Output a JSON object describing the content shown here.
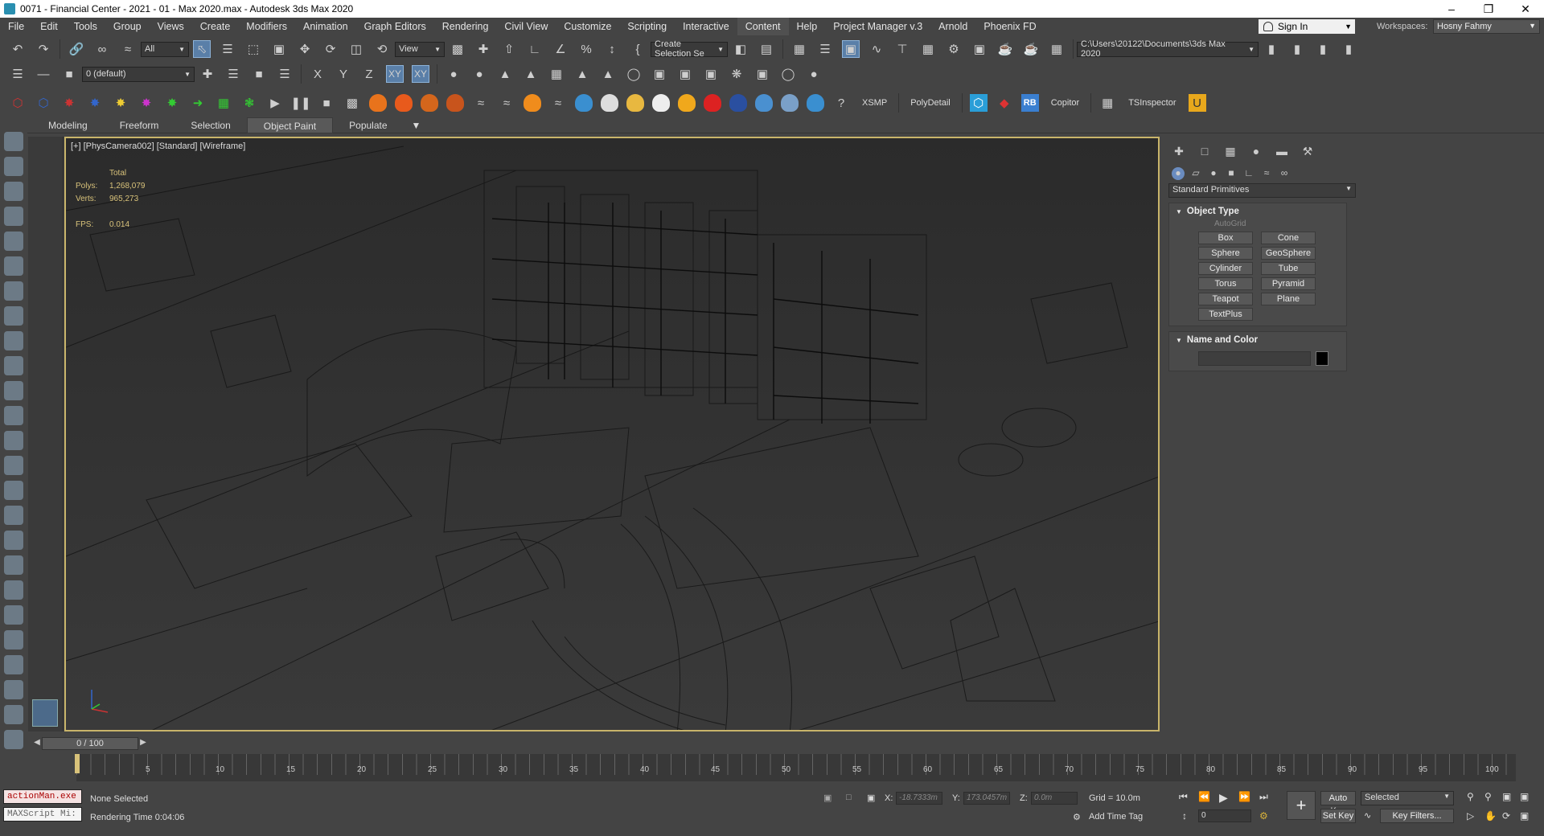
{
  "window": {
    "title": "0071 - Financial Center - 2021 - 01 - Max 2020.max - Autodesk 3ds Max 2020",
    "min_icon": "minimize-icon",
    "max_icon": "maximize-icon",
    "close_icon": "close-icon"
  },
  "menu": {
    "items": [
      "File",
      "Edit",
      "Tools",
      "Group",
      "Views",
      "Create",
      "Modifiers",
      "Animation",
      "Graph Editors",
      "Rendering",
      "Civil View",
      "Customize",
      "Scripting",
      "Interactive",
      "Content",
      "Help",
      "Project Manager v.3",
      "Arnold",
      "Phoenix FD"
    ],
    "highlighted": "Content"
  },
  "account": {
    "sign_in": "Sign In",
    "workspaces_label": "Workspaces:",
    "workspace": "Hosny Fahmy"
  },
  "toolbar1": {
    "filter": "All",
    "view_dropdown": "View",
    "named_selection": "Create Selection Se",
    "path": "C:\\Users\\20122\\Documents\\3ds Max 2020"
  },
  "toolbar2": {
    "layer": "0 (default)",
    "axis_x": "X",
    "axis_y": "Y",
    "axis_z": "Z",
    "axis_xy": "XY",
    "axis_xy2": "XY"
  },
  "toolbar3": {
    "xsmp": "XSMP",
    "polydetail": "PolyDetail",
    "rb": "RB",
    "copitor": "Copitor",
    "tsinspector": "TSInspector"
  },
  "ribbon": {
    "tabs": [
      "Modeling",
      "Freeform",
      "Selection",
      "Object Paint",
      "Populate"
    ],
    "active": "Object Paint"
  },
  "viewport": {
    "label": "[+] [PhysCamera002] [Standard] [Wireframe]",
    "stats": {
      "total": "Total",
      "polys_label": "Polys:",
      "polys": "1,268,079",
      "verts_label": "Verts:",
      "verts": "965,273",
      "fps_label": "FPS:",
      "fps": "0.014"
    }
  },
  "command_panel": {
    "category": "Standard Primitives",
    "object_type_title": "Object Type",
    "autogrid": "AutoGrid",
    "buttons": [
      "Box",
      "Cone",
      "Sphere",
      "GeoSphere",
      "Cylinder",
      "Tube",
      "Torus",
      "Pyramid",
      "Teapot",
      "Plane",
      "TextPlus"
    ],
    "name_color_title": "Name and Color",
    "swatch_color": "#000000"
  },
  "timeline": {
    "frame": "0 / 100",
    "ticks": [
      "5",
      "10",
      "15",
      "20",
      "25",
      "30",
      "35",
      "40",
      "45",
      "50",
      "55",
      "60",
      "65",
      "70",
      "75",
      "80",
      "85",
      "90",
      "95",
      "100"
    ]
  },
  "status": {
    "maxscript_listener": "actionMan.exe",
    "maxscript_mini": "MAXScript Mi:",
    "selection": "None Selected",
    "render_time": "Rendering Time  0:04:06",
    "x_label": "X:",
    "x": "-18.7333m",
    "y_label": "Y:",
    "y": "173.0457m",
    "z_label": "Z:",
    "z": "0.0m",
    "grid": "Grid = 10.0m",
    "add_time_tag": "Add Time Tag",
    "auto_key": "Auto Key",
    "set_key": "Set Key",
    "selected": "Selected",
    "key_filters": "Key Filters...",
    "frame_field": "0"
  }
}
